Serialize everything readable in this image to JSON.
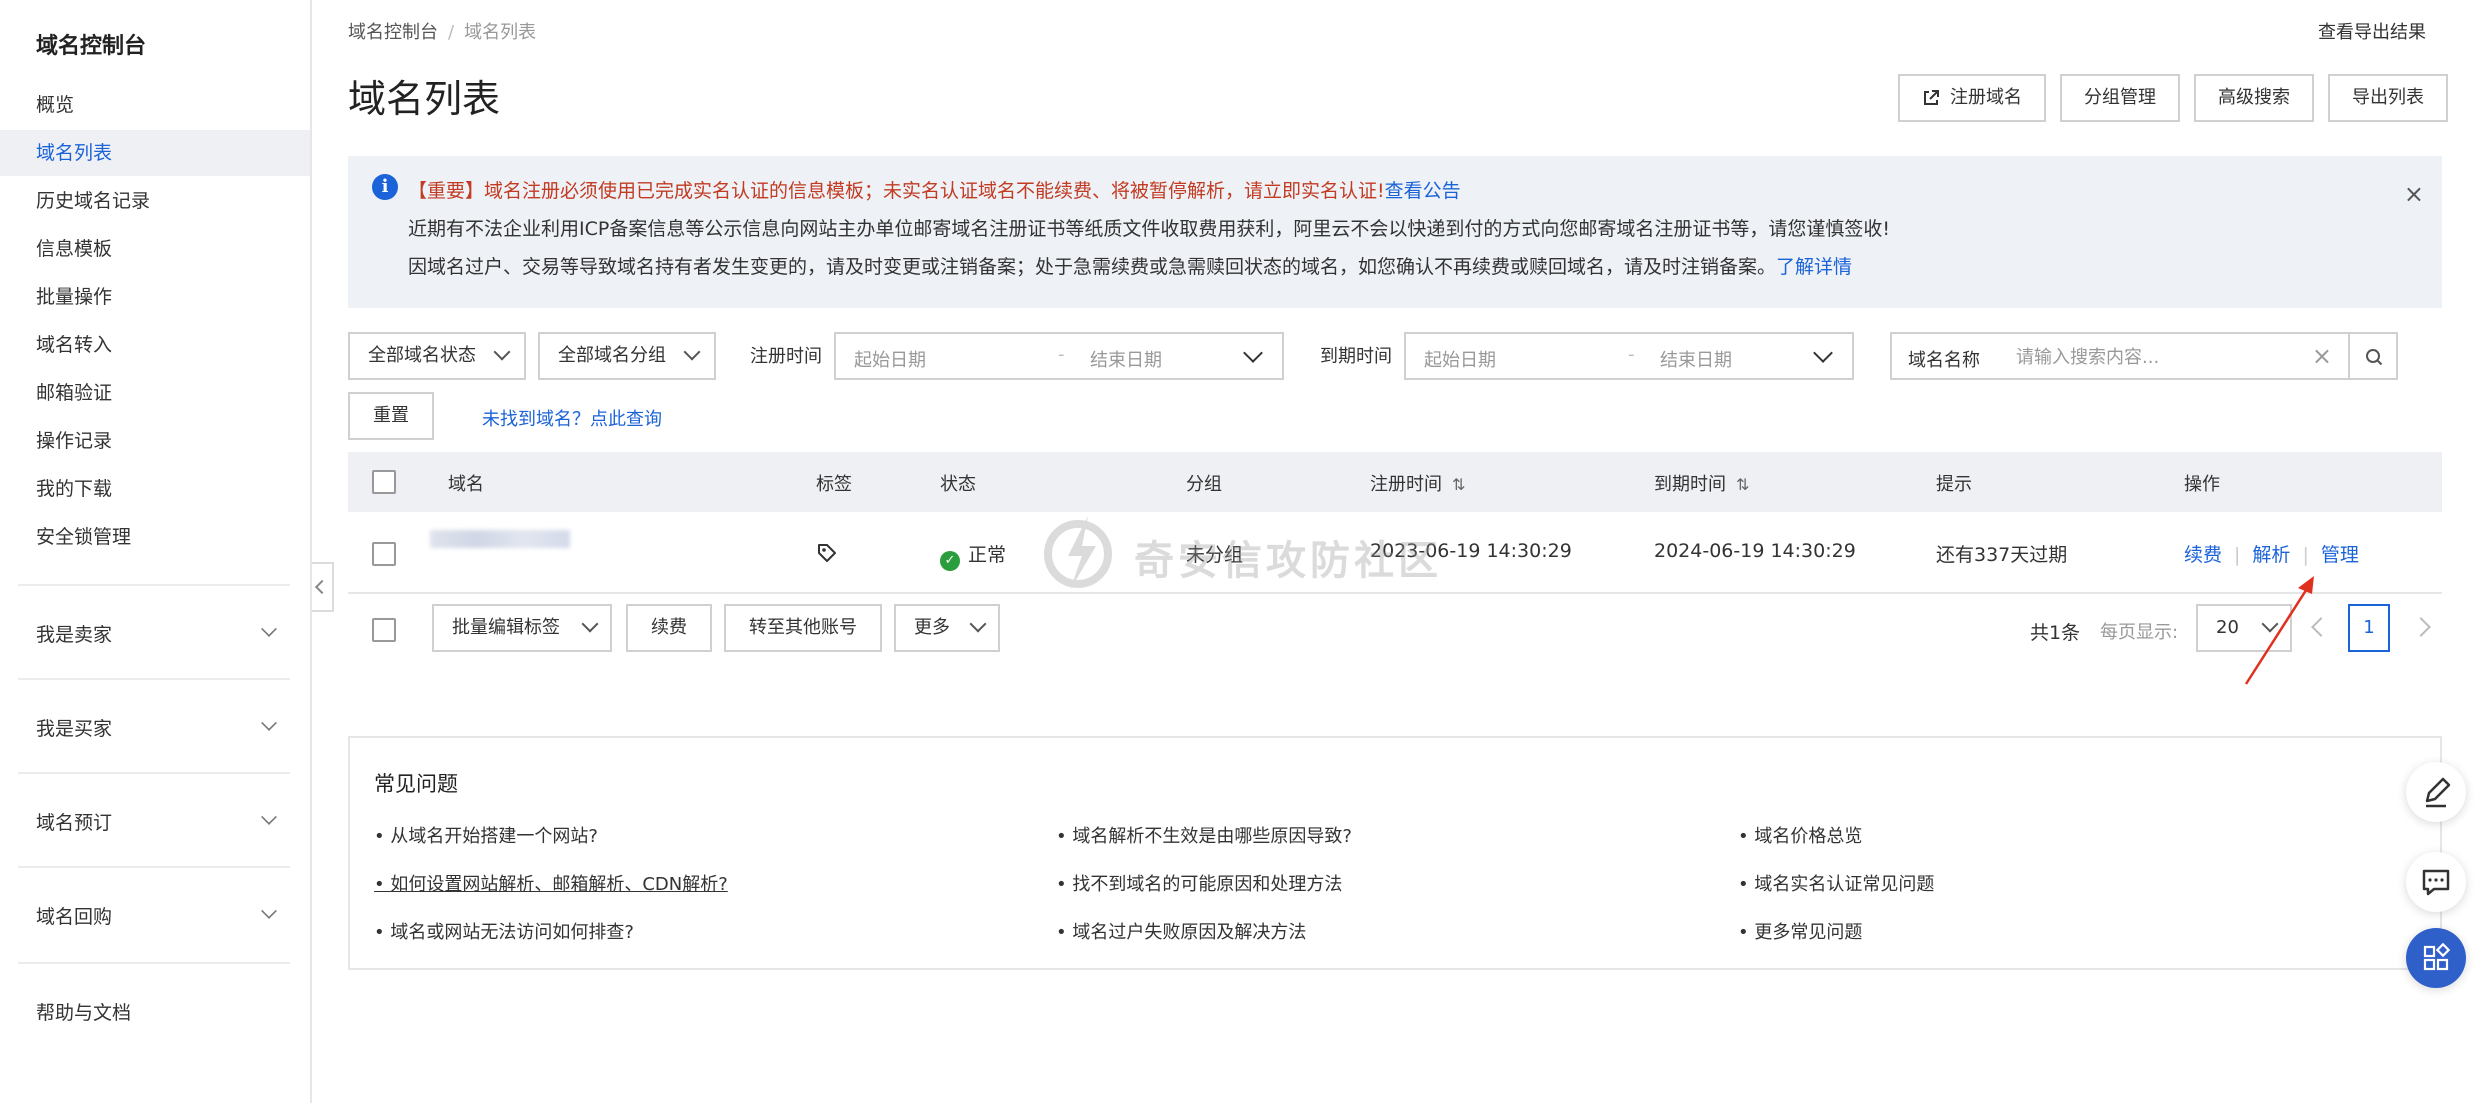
{
  "sidebar": {
    "title": "域名控制台",
    "items": [
      {
        "label": "概览"
      },
      {
        "label": "域名列表"
      },
      {
        "label": "历史域名记录"
      },
      {
        "label": "信息模板"
      },
      {
        "label": "批量操作"
      },
      {
        "label": "域名转入"
      },
      {
        "label": "邮箱验证"
      },
      {
        "label": "操作记录"
      },
      {
        "label": "我的下载"
      },
      {
        "label": "安全锁管理"
      }
    ],
    "groups": [
      {
        "label": "我是卖家"
      },
      {
        "label": "我是买家"
      },
      {
        "label": "域名预订"
      },
      {
        "label": "域名回购"
      }
    ],
    "help": "帮助与文档"
  },
  "breadcrumb": {
    "root": "域名控制台",
    "sep": "/",
    "current": "域名列表"
  },
  "export_result": "查看导出结果",
  "page_title": "域名列表",
  "top_buttons": {
    "register": "注册域名",
    "group": "分组管理",
    "advanced": "高级搜索",
    "export": "导出列表"
  },
  "notice": {
    "line1": "【重要】域名注册必须使用已完成实名认证的信息模板；未实名认证域名不能续费、将被暂停解析，请立即实名认证!",
    "line1_link": "查看公告",
    "line2": "近期有不法企业利用ICP备案信息等公示信息向网站主办单位邮寄域名注册证书等纸质文件收取费用获利，阿里云不会以快递到付的方式向您邮寄域名注册证书等，请您谨慎签收!",
    "line3": "因域名过户、交易等导致域名持有者发生变更的，请及时变更或注销备案；处于急需续费或急需赎回状态的域名，如您确认不再续费或赎回域名，请及时注销备案。",
    "line3_link": "了解详情",
    "close": "×"
  },
  "filters": {
    "status": "全部域名状态",
    "group": "全部域名分组",
    "reg_label": "注册时间",
    "exp_label": "到期时间",
    "start_ph": "起始日期",
    "dash": "-",
    "end_ph": "结束日期",
    "search_key": "域名名称",
    "search_placeholder": "请输入搜索内容...",
    "clear": "×",
    "reset": "重置",
    "not_found": "未找到域名？点此查询"
  },
  "table": {
    "headers": {
      "domain": "域名",
      "tag": "标签",
      "status": "状态",
      "group": "分组",
      "reg_time": "注册时间",
      "exp_time": "到期时间",
      "hint": "提示",
      "action": "操作"
    },
    "sort_glyph": "⇅",
    "rows": [
      {
        "status": "正常",
        "group": "未分组",
        "reg_time": "2023-06-19 14:30:29",
        "exp_time": "2024-06-19 14:30:29",
        "hint": "还有337天过期",
        "actions": [
          "续费",
          "解析",
          "管理"
        ]
      }
    ]
  },
  "watermark": "奇安信攻防社区",
  "batch": {
    "edit_tags": "批量编辑标签",
    "renew": "续费",
    "transfer": "转至其他账号",
    "more": "更多"
  },
  "pagination": {
    "total": "共1条",
    "per_page_label": "每页显示:",
    "page_size": "20",
    "current": "1"
  },
  "faq": {
    "title": "常见问题",
    "items": [
      "• 从域名开始搭建一个网站?",
      "• 如何设置网站解析、邮箱解析、CDN解析?",
      "• 域名或网站无法访问如何排查?",
      "• 域名解析不生效是由哪些原因导致?",
      "• 找不到域名的可能原因和处理方法",
      "• 域名过户失败原因及解决方法",
      "• 域名价格总览",
      "• 域名实名认证常见问题",
      "• 更多常见问题"
    ]
  },
  "colors": {
    "accent": "#1a63d8",
    "warning": "#c23b22",
    "success": "#2a9d3c",
    "arrow": "#e0301e"
  }
}
